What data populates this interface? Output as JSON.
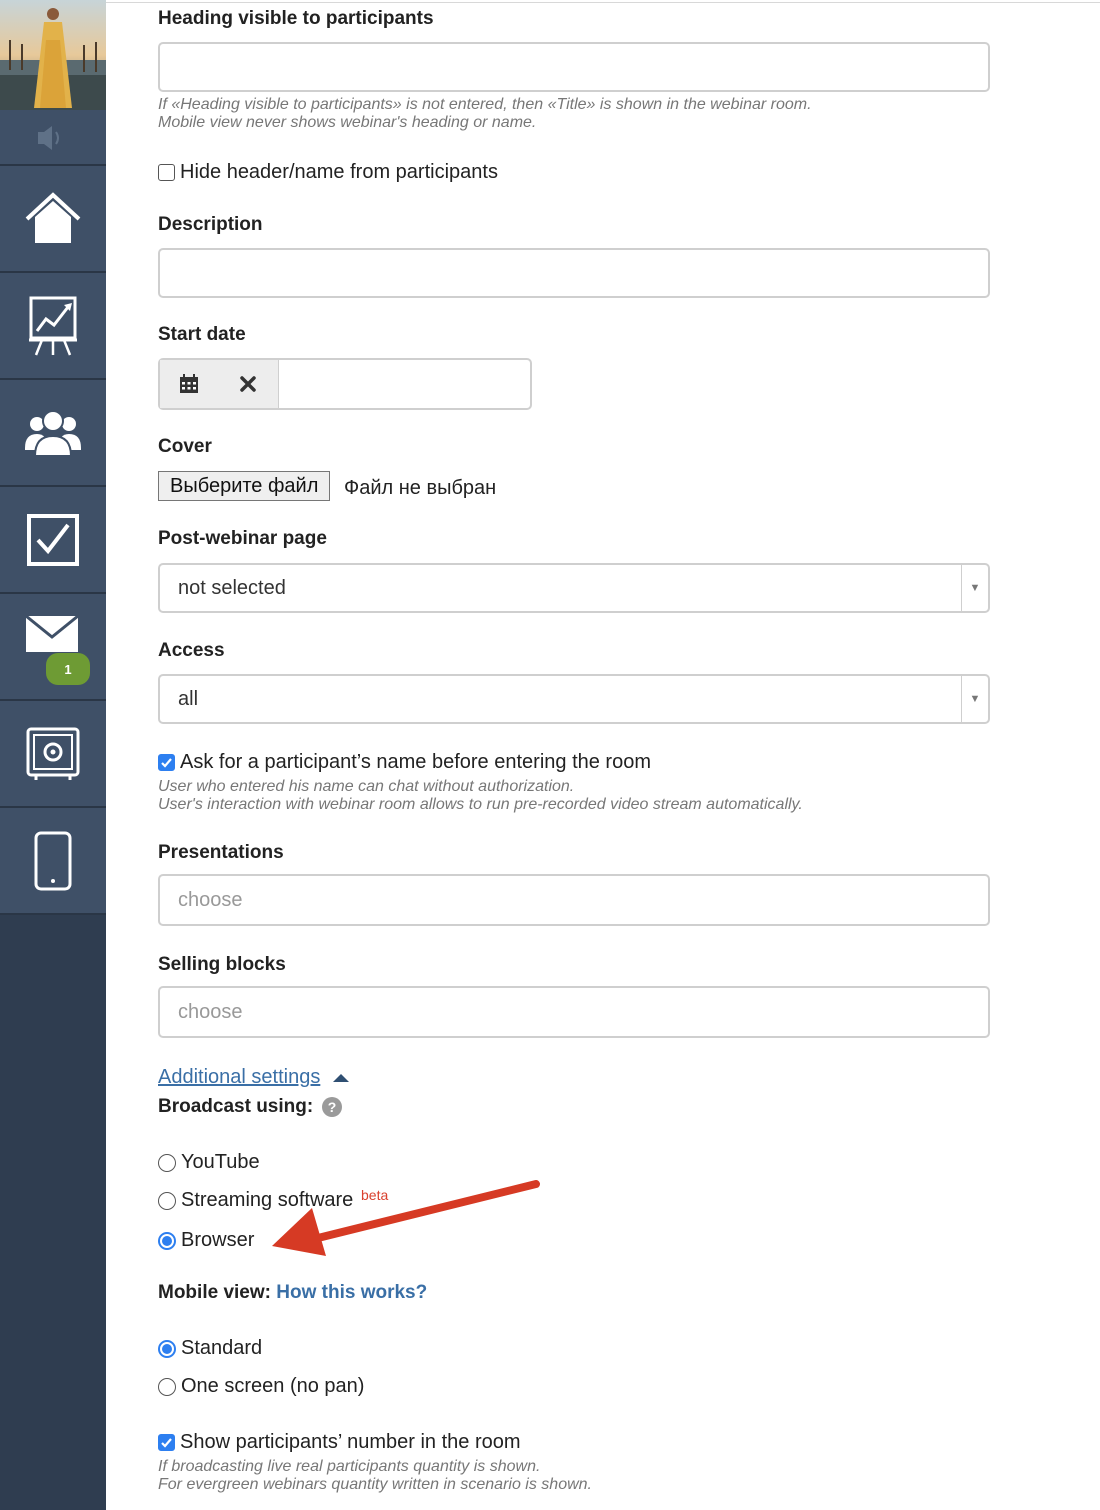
{
  "sidebar": {
    "items": [
      {
        "name": "home"
      },
      {
        "name": "statistics"
      },
      {
        "name": "users"
      },
      {
        "name": "tasks"
      },
      {
        "name": "mail",
        "badge": "1"
      },
      {
        "name": "safe"
      },
      {
        "name": "mobile"
      }
    ]
  },
  "form": {
    "heading": {
      "label": "Heading visible to participants",
      "value": "",
      "help1": "If «Heading visible to participants» is not entered, then «Title» is shown in the webinar room.",
      "help2": "Mobile view never shows webinar's heading or name."
    },
    "hide_header": {
      "label": "Hide header/name from participants",
      "checked": false
    },
    "description": {
      "label": "Description",
      "value": ""
    },
    "start_date": {
      "label": "Start date",
      "value": ""
    },
    "cover": {
      "label": "Cover",
      "button": "Выберите файл",
      "status": "Файл не выбран"
    },
    "post_webinar": {
      "label": "Post-webinar page",
      "value": "not selected"
    },
    "access": {
      "label": "Access",
      "value": "all"
    },
    "ask_name": {
      "label": "Ask for a participant’s name before entering the room",
      "checked": true,
      "help1": "User who entered his name can chat without authorization.",
      "help2": "User's interaction with webinar room allows to run pre-recorded video stream automatically."
    },
    "presentations": {
      "label": "Presentations",
      "placeholder": "choose"
    },
    "selling_blocks": {
      "label": "Selling blocks",
      "placeholder": "choose"
    },
    "additional_settings": "Additional settings",
    "broadcast": {
      "label": "Broadcast using:",
      "options": [
        "YouTube",
        "Streaming software",
        "Browser"
      ],
      "beta": "beta",
      "selected": "Browser"
    },
    "mobile_view": {
      "label": "Mobile view:",
      "link": "How this works?",
      "options": [
        "Standard",
        "One screen (no pan)"
      ],
      "selected": "Standard"
    },
    "show_number": {
      "label": "Show participants’ number in the room",
      "checked": true,
      "help1": "If broadcasting live real participants quantity is shown.",
      "help2": "For evergreen webinars quantity written in scenario is shown."
    }
  },
  "colors": {
    "sidebar_bg": "#2f3d50",
    "sidebar_item": "#3f5067",
    "accent_blue": "#2d7ff0",
    "link_blue": "#3a6fa6",
    "badge_green": "#6e9b34",
    "beta_red": "#d9412e",
    "arrow_red": "#d63a24"
  }
}
